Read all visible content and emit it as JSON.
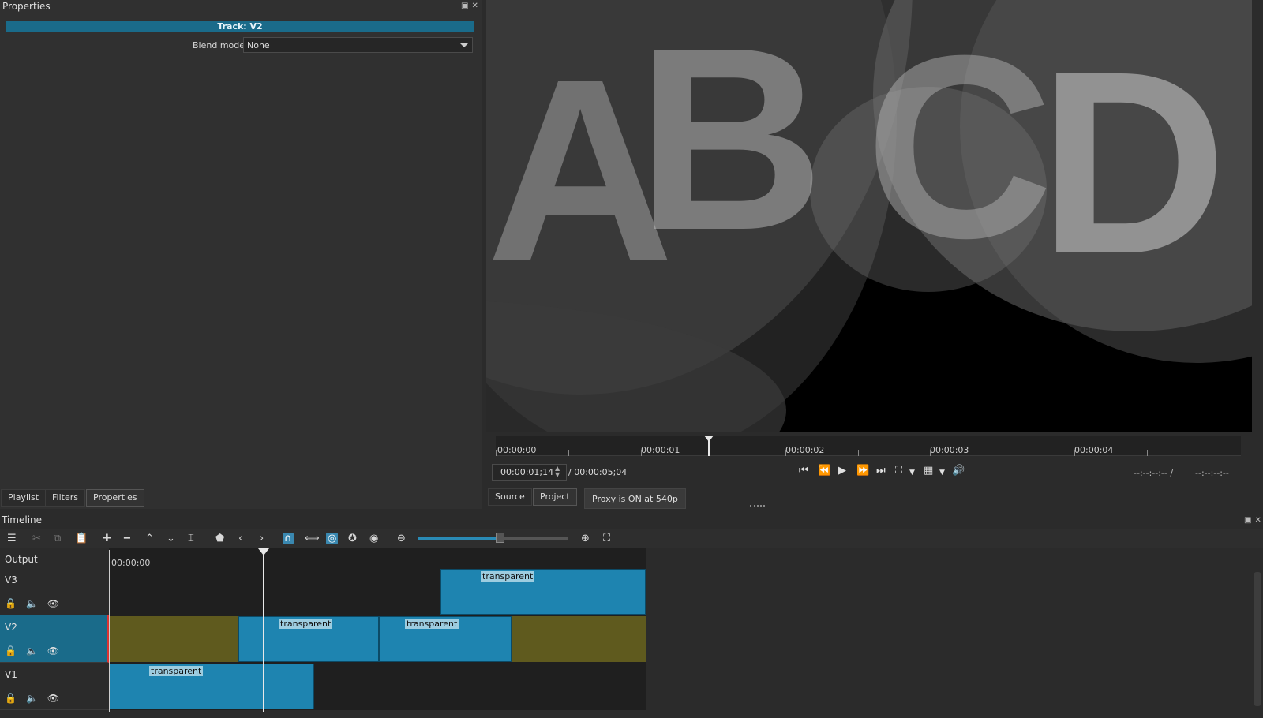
{
  "properties": {
    "title": "Properties",
    "track_header": "Track: V2",
    "blend_label": "Blend mode",
    "blend_value": "None"
  },
  "left_tabs": [
    "Playlist",
    "Filters",
    "Properties"
  ],
  "viewer": {
    "ruler_labels": [
      "00:00:00",
      "00:00:01",
      "00:00:02",
      "00:00:03",
      "00:00:04"
    ],
    "timecode": "00:00:01;14",
    "duration": "/ 00:00:05;04",
    "tc_in": "--:--:--:-- /",
    "tc_out": "--:--:--:--",
    "preview_letters": [
      "A",
      "B",
      "C",
      "D"
    ]
  },
  "viewer_tabs": [
    "Source",
    "Project"
  ],
  "proxy_status": "Proxy is ON at 540p",
  "timeline": {
    "title": "Timeline",
    "time_start": "00:00:00",
    "output_label": "Output",
    "tracks": [
      {
        "name": "V3",
        "selected": false
      },
      {
        "name": "V2",
        "selected": true
      },
      {
        "name": "V1",
        "selected": false
      }
    ],
    "clip_label": "transparent"
  },
  "colors": {
    "accent": "#1a6b8a",
    "clip": "#1e84b0",
    "blank": "#5f5a1e"
  }
}
